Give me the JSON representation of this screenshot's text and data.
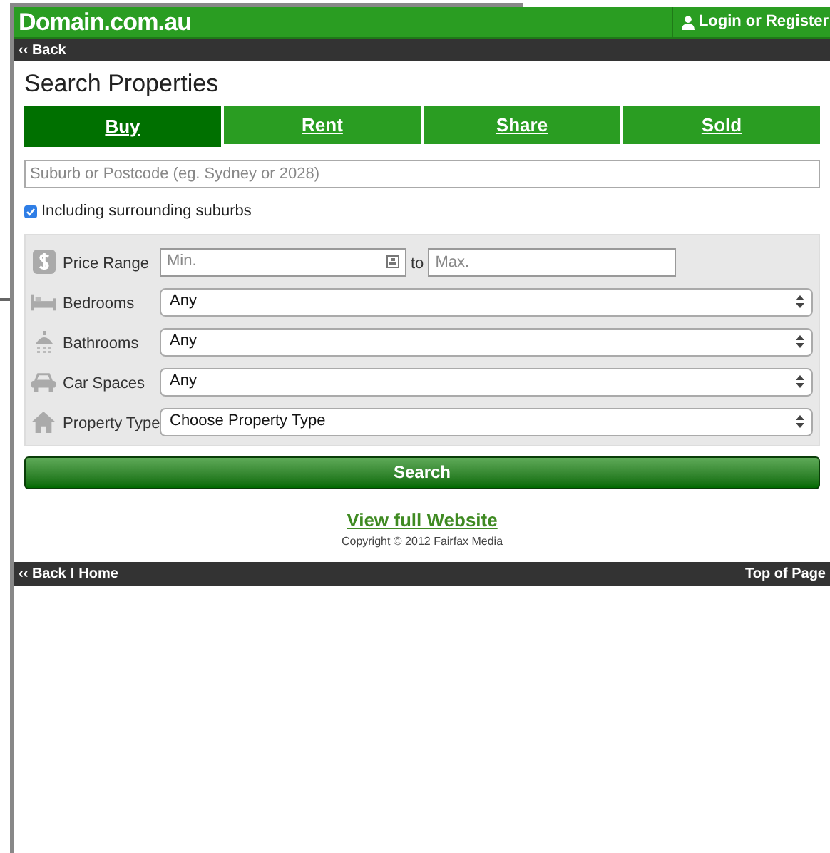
{
  "header": {
    "logo": "Domain.com.au",
    "login": "Login or Register"
  },
  "back_bar": {
    "back": "‹‹ Back"
  },
  "title": "Search Properties",
  "tabs": [
    {
      "label": "Buy",
      "selected": true
    },
    {
      "label": "Rent",
      "selected": false
    },
    {
      "label": "Share",
      "selected": false
    },
    {
      "label": "Sold",
      "selected": false
    }
  ],
  "location": {
    "placeholder": "Suburb or Postcode (eg. Sydney or 2028)"
  },
  "surrounding": {
    "label": "Including surrounding suburbs",
    "checked": true
  },
  "filters": [
    {
      "kind": "range",
      "label": "Price Range",
      "min_placeholder": "Min.",
      "separator": "to",
      "max_placeholder": "Max."
    },
    {
      "kind": "select",
      "label": "Bedrooms",
      "value": "Any"
    },
    {
      "kind": "select",
      "label": "Bathrooms",
      "value": "Any"
    },
    {
      "kind": "select",
      "label": "Car Spaces",
      "value": "Any"
    },
    {
      "kind": "select",
      "label": "Property Type",
      "value": "Choose Property Type"
    }
  ],
  "search_button": "Search",
  "full_site_link": "View full Website",
  "copyright": "Copyright © 2012 Fairfax Media",
  "footer": {
    "back": "‹‹ Back",
    "separator": "I",
    "home": "Home",
    "top": "Top of Page"
  }
}
